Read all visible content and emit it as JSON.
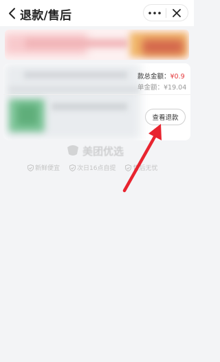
{
  "header": {
    "title": "退款/售后"
  },
  "order": {
    "refund_total_label": "款总金额：",
    "refund_total_value": "¥0.9",
    "order_amount_label": "单金额：",
    "order_amount_value": "¥19.04",
    "view_refund_button": "查看退款"
  },
  "brand": {
    "name": "美团优选"
  },
  "features": [
    {
      "label": "新鲜便宜"
    },
    {
      "label": "次日16点自提"
    },
    {
      "label": "售后无忧"
    }
  ],
  "colors": {
    "price_red": "#e4393c",
    "annotation_arrow": "#e8242f"
  }
}
